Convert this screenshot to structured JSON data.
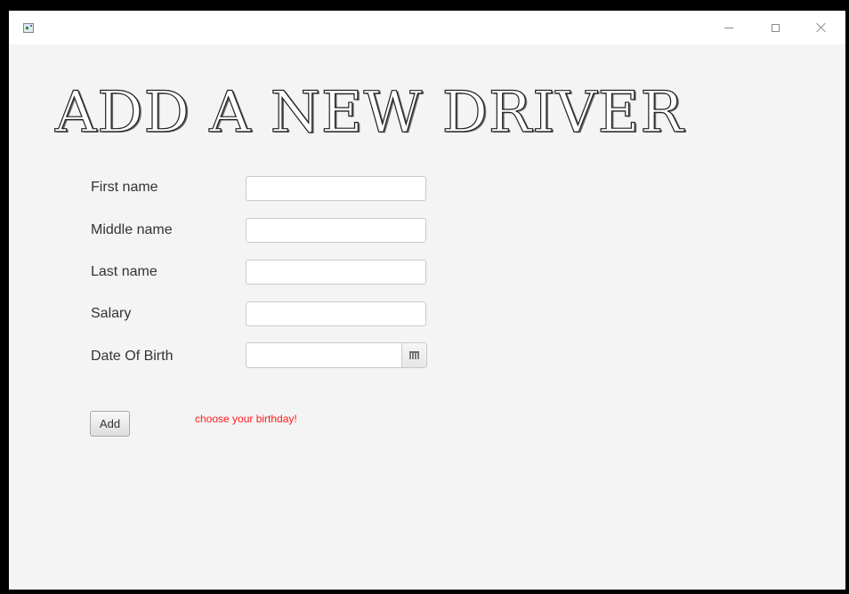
{
  "window": {
    "title": "",
    "icons": {
      "app": "app-icon",
      "minimize": "minimize-icon",
      "maximize": "maximize-icon",
      "close": "close-icon"
    }
  },
  "form": {
    "heading": "ADD A NEW DRIVER",
    "fields": [
      {
        "label": "First name",
        "value": ""
      },
      {
        "label": "Middle name",
        "value": ""
      },
      {
        "label": "Last name",
        "value": ""
      },
      {
        "label": "Salary",
        "value": ""
      },
      {
        "label": "Date Of Birth",
        "value": ""
      }
    ],
    "add_button": "Add",
    "error_message": "choose your birthday!",
    "error_color": "#ff1a1a"
  }
}
